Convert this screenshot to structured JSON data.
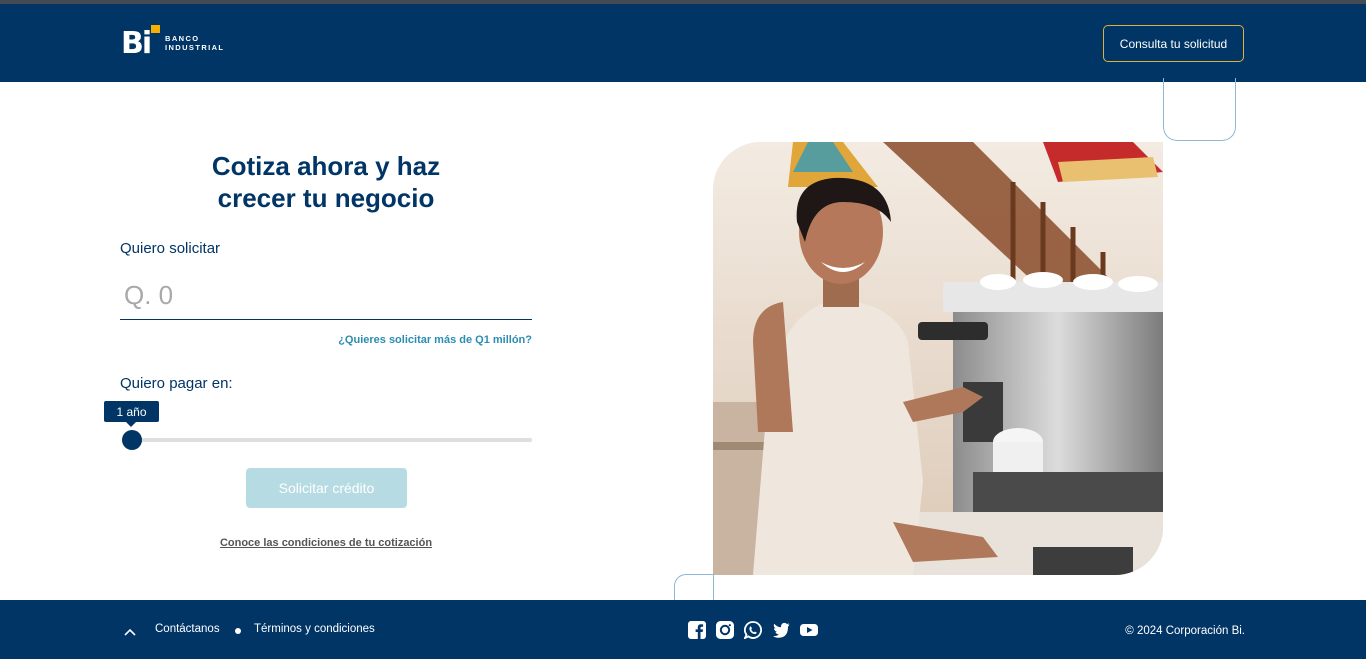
{
  "header": {
    "logo_text_line1": "BANCO",
    "logo_text_line2": "INDUSTRIAL",
    "logo_mark": "Bi",
    "consulta_label": "Consulta tu solicitud"
  },
  "form": {
    "title_line1": "Cotiza ahora y haz",
    "title_line2": "crecer tu negocio",
    "amount_label": "Quiero solicitar",
    "amount_placeholder": "Q. 0",
    "more_link": "¿Quieres solicitar más de Q1 millón?",
    "term_label": "Quiero pagar en:",
    "term_value": "1 año",
    "slider_fraction": 0,
    "submit_label": "Solicitar crédito",
    "conditions_link": "Conoce las condiciones de tu cotización"
  },
  "footer": {
    "contact": "Contáctanos",
    "terms": "Términos y condiciones",
    "social_icons": [
      "facebook-icon",
      "instagram-icon",
      "whatsapp-icon",
      "twitter-icon",
      "youtube-icon"
    ],
    "copyright": "© 2024 Corporación Bi."
  },
  "colors": {
    "brand_navy": "#003566",
    "accent_yellow": "#f5b100",
    "button_disabled": "#b6dbe3",
    "link_blue": "#2b8db3"
  }
}
